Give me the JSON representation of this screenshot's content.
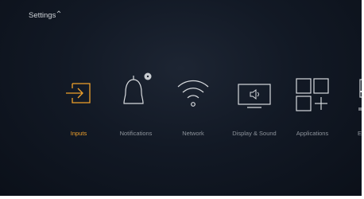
{
  "header": {
    "title": "Settings"
  },
  "menu": {
    "selected_index": 0,
    "items": [
      {
        "label": "Inputs",
        "icon": "input-arrow-icon"
      },
      {
        "label": "Notifications",
        "icon": "bell-icon"
      },
      {
        "label": "Network",
        "icon": "wifi-icon"
      },
      {
        "label": "Display & Sound",
        "icon": "display-sound-icon"
      },
      {
        "label": "Applications",
        "icon": "applications-grid-icon"
      },
      {
        "label": "E",
        "icon": "equipment-icon"
      }
    ]
  },
  "colors": {
    "accent": "#f0a12b",
    "icon": "#d7dade",
    "label": "#8e949c",
    "background": "#121925"
  }
}
